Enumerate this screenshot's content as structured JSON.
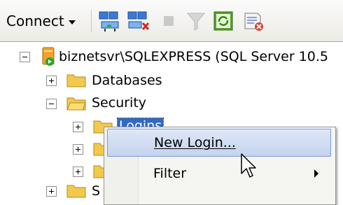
{
  "toolbar": {
    "connect_label": "Connect",
    "icons": [
      "connect-object-explorer-icon",
      "disconnect-icon",
      "stop-icon",
      "filter-icon",
      "refresh-icon",
      "summary-icon"
    ]
  },
  "tree": {
    "server": "biznetsvr\\SQLEXPRESS (SQL Server 10.5",
    "nodes": [
      {
        "label": "Databases"
      },
      {
        "label": "Security"
      },
      {
        "label": "Logins"
      },
      {
        "label": ""
      },
      {
        "label": ""
      },
      {
        "label": "S"
      }
    ]
  },
  "context_menu": {
    "items": [
      {
        "label": "New Login...",
        "mnemonic": "N"
      },
      {
        "label": "Filter"
      }
    ]
  },
  "colors": {
    "selection": "#316ac5",
    "menu_highlight": "#c4d3ef",
    "folder": "#f2c94c"
  }
}
